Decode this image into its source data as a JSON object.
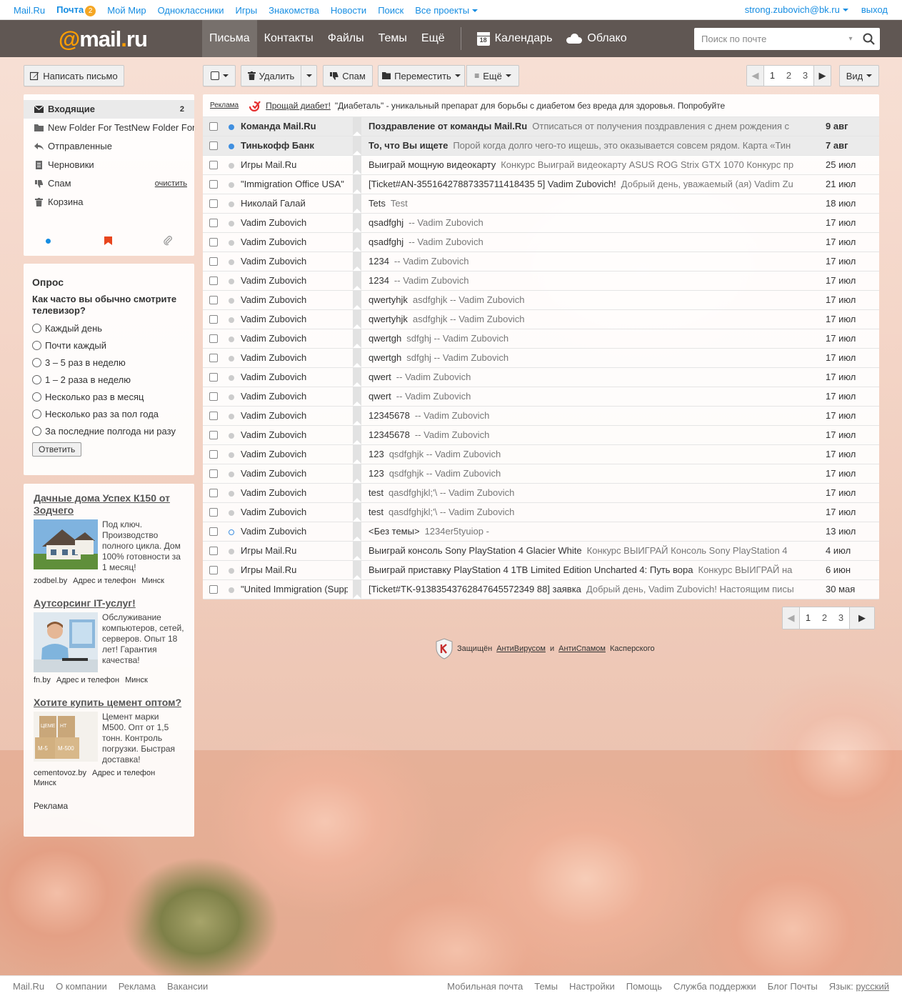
{
  "portal": {
    "links": [
      "Mail.Ru",
      "Почта",
      "Мой Мир",
      "Одноклассники",
      "Игры",
      "Знакомства",
      "Новости",
      "Поиск",
      "Все проекты"
    ],
    "mail_badge": "2",
    "user_email": "strong.zubovich@bk.ru",
    "logout": "выход"
  },
  "header": {
    "logo_at": "@",
    "logo_text": "mail",
    "logo_dot": ".",
    "logo_ru": "ru",
    "nav": [
      "Письма",
      "Контакты",
      "Файлы",
      "Темы",
      "Ещё"
    ],
    "calendar": "Календарь",
    "calendar_day": "18",
    "cloud": "Облако",
    "search_placeholder": "Поиск по почте"
  },
  "toolbar": {
    "compose": "Написать письмо",
    "delete": "Удалить",
    "spam": "Спам",
    "move": "Переместить",
    "more": "Ещё",
    "view": "Вид",
    "pages": [
      "1",
      "2",
      "3"
    ]
  },
  "folders": {
    "inbox": "Входящие",
    "inbox_count": "2",
    "custom": "New Folder For TestNew Folder For",
    "sent": "Отправленные",
    "drafts": "Черновики",
    "spam": "Спам",
    "spam_clean": "очистить",
    "trash": "Корзина"
  },
  "poll": {
    "title": "Опрос",
    "question": "Как часто вы обычно смотрите телевизор?",
    "options": [
      "Каждый день",
      "Почти каждый",
      "3 – 5 раз в неделю",
      "1 – 2 раза в неделю",
      "Несколько раз в месяц",
      "Несколько раз за пол года",
      "За последние полгода ни разу"
    ],
    "submit": "Ответить"
  },
  "ads": [
    {
      "title": "Дачные дома Успех К150 от Зодчего",
      "text": "Под ключ. Производство полного цикла. Дом 100% готовности за 1 месяц!",
      "site": "zodbel.by",
      "addr": "Адрес и телефон",
      "city": "Минск"
    },
    {
      "title": "Аутсорсинг IT-услуг!",
      "text": "Обслуживание компьютеров, сетей, серверов. Опыт 18 лет! Гарантия качества!",
      "site": "fn.by",
      "addr": "Адрес и телефон",
      "city": "Минск"
    },
    {
      "title": "Хотите купить цемент оптом?",
      "text": "Цемент марки М500. Опт от 1,5 тонн. Контроль погрузки. Быстрая доставка!",
      "site": "cementovoz.by",
      "addr": "Адрес и телефон",
      "city": "Минск"
    }
  ],
  "ads_label": "Реклама",
  "cement_bag_labels": [
    "ЦЕМЕ",
    "НТ",
    "М-5",
    "М-500"
  ],
  "top_ad": {
    "label": "Реклама",
    "link": "Прощай диабет!",
    "text": "\"Диабеталь\" - уникальный препарат для борьбы с диабетом без вреда для здоровья. Попробуйте"
  },
  "messages": [
    {
      "from": "Команда Mail.Ru",
      "subject": "Поздравление от команды Mail.Ru",
      "preview": "Отписаться от получения поздравления с днем рождения с",
      "date": "9 авг",
      "unread": true
    },
    {
      "from": "Тинькофф Банк",
      "subject": "То, что Вы ищете",
      "preview": "Порой когда долго чего-то ищешь, это оказывается совсем рядом. Карта «Тин",
      "date": "7 авг",
      "unread": true
    },
    {
      "from": "Игры Mail.Ru",
      "subject": "Выиграй мощную видеокарту",
      "preview": "Конкурс Выиграй видеокарту ASUS ROG Strix GTX 1070 Конкурс пр",
      "date": "25 июл",
      "unread": false
    },
    {
      "from": "\"Immigration Office USA\"",
      "subject": "[Ticket#AN-35516427887335711418435 5] Vadim Zubovich!",
      "preview": "Добрый день, уважаемый (ая) Vadim Zub",
      "date": "21 июл",
      "unread": false
    },
    {
      "from": "Николай Галай",
      "subject": "Tets",
      "preview": "Test",
      "date": "18 июл",
      "unread": false
    },
    {
      "from": "Vadim Zubovich",
      "subject": "qsadfghj",
      "preview": "-- Vadim Zubovich",
      "date": "17 июл",
      "unread": false
    },
    {
      "from": "Vadim Zubovich",
      "subject": "qsadfghj",
      "preview": "-- Vadim Zubovich",
      "date": "17 июл",
      "unread": false
    },
    {
      "from": "Vadim Zubovich",
      "subject": "1234",
      "preview": "-- Vadim Zubovich",
      "date": "17 июл",
      "unread": false
    },
    {
      "from": "Vadim Zubovich",
      "subject": "1234",
      "preview": "-- Vadim Zubovich",
      "date": "17 июл",
      "unread": false
    },
    {
      "from": "Vadim Zubovich",
      "subject": "qwertyhjk",
      "preview": "asdfghjk -- Vadim Zubovich",
      "date": "17 июл",
      "unread": false
    },
    {
      "from": "Vadim Zubovich",
      "subject": "qwertyhjk",
      "preview": "asdfghjk -- Vadim Zubovich",
      "date": "17 июл",
      "unread": false
    },
    {
      "from": "Vadim Zubovich",
      "subject": "qwertgh",
      "preview": "sdfghj -- Vadim Zubovich",
      "date": "17 июл",
      "unread": false
    },
    {
      "from": "Vadim Zubovich",
      "subject": "qwertgh",
      "preview": "sdfghj -- Vadim Zubovich",
      "date": "17 июл",
      "unread": false
    },
    {
      "from": "Vadim Zubovich",
      "subject": "qwert",
      "preview": "-- Vadim Zubovich",
      "date": "17 июл",
      "unread": false
    },
    {
      "from": "Vadim Zubovich",
      "subject": "qwert",
      "preview": "-- Vadim Zubovich",
      "date": "17 июл",
      "unread": false
    },
    {
      "from": "Vadim Zubovich",
      "subject": "12345678",
      "preview": "-- Vadim Zubovich",
      "date": "17 июл",
      "unread": false
    },
    {
      "from": "Vadim Zubovich",
      "subject": "12345678",
      "preview": "-- Vadim Zubovich",
      "date": "17 июл",
      "unread": false
    },
    {
      "from": "Vadim Zubovich",
      "subject": "123",
      "preview": "qsdfghjk -- Vadim Zubovich",
      "date": "17 июл",
      "unread": false
    },
    {
      "from": "Vadim Zubovich",
      "subject": "123",
      "preview": "qsdfghjk -- Vadim Zubovich",
      "date": "17 июл",
      "unread": false
    },
    {
      "from": "Vadim Zubovich",
      "subject": "test",
      "preview": "qasdfghjkl;'\\ -- Vadim Zubovich",
      "date": "17 июл",
      "unread": false
    },
    {
      "from": "Vadim Zubovich",
      "subject": "test",
      "preview": "qasdfghjkl;'\\ -- Vadim Zubovich",
      "date": "17 июл",
      "unread": false
    },
    {
      "from": "Vadim Zubovich",
      "subject": "<Без темы>",
      "preview": "1234er5tyuiop -",
      "date": "13 июл",
      "unread": false,
      "ring": true
    },
    {
      "from": "Игры Mail.Ru",
      "subject": "Выиграй консоль Sony PlayStation 4 Glacier White",
      "preview": "Конкурс ВЫИГРАЙ Консоль Sony PlayStation 4",
      "date": "4 июл",
      "unread": false
    },
    {
      "from": "Игры Mail.Ru",
      "subject": "Выиграй приставку PlayStation 4 1TB Limited Edition Uncharted 4: Путь вора",
      "preview": "Конкурс ВЫИГРАЙ на",
      "date": "6 июн",
      "unread": false
    },
    {
      "from": "\"United Immigration (Support)\"",
      "subject": "[Ticket#TK-91383543762847645572349 88] заявка",
      "preview": "Добрый день, Vadim Zubovich! Настоящим письм",
      "date": "30 мая",
      "unread": false
    }
  ],
  "kaspersky": {
    "prefix": "Защищён",
    "antivirus": "АнтиВирусом",
    "and": "и",
    "antispam": "АнтиСпамом",
    "suffix": "Касперского"
  },
  "footer": {
    "left": [
      "Mail.Ru",
      "О компании",
      "Реклама",
      "Вакансии"
    ],
    "right": [
      "Мобильная почта",
      "Темы",
      "Настройки",
      "Помощь",
      "Служба поддержки",
      "Блог Почты"
    ],
    "lang_label": "Язык:",
    "lang": "русский"
  }
}
